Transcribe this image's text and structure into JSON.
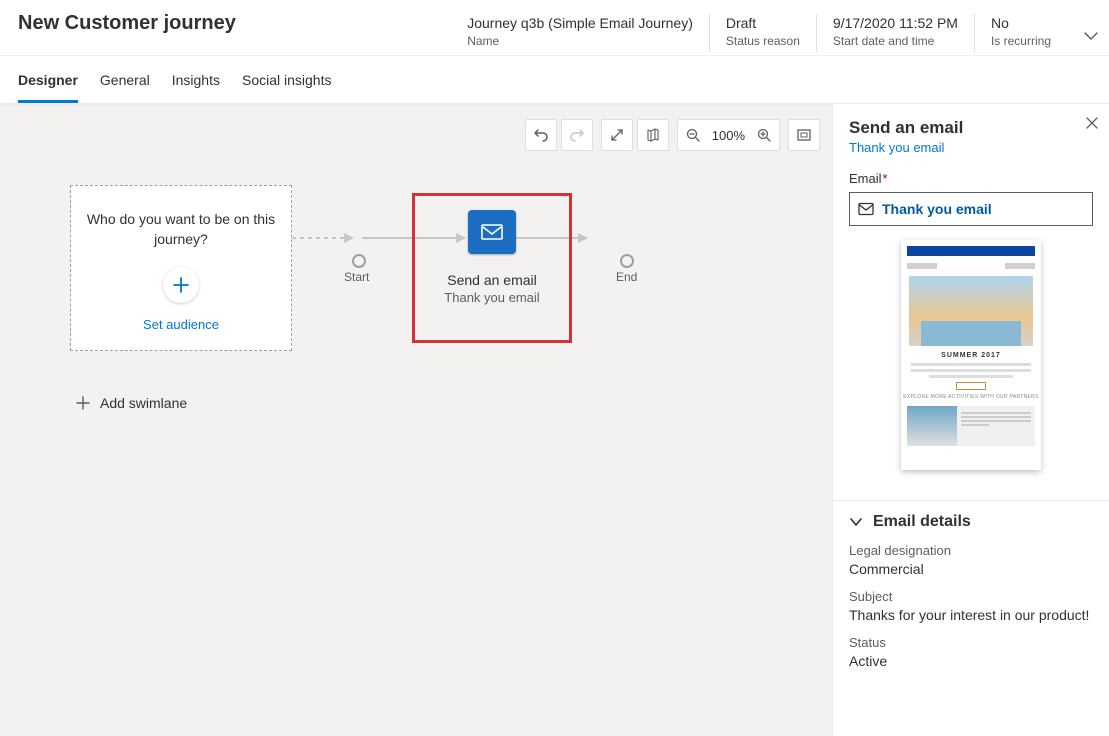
{
  "header": {
    "title": "New Customer journey",
    "name": {
      "value": "Journey q3b (Simple Email Journey)",
      "label": "Name"
    },
    "status": {
      "value": "Draft",
      "label": "Status reason"
    },
    "start": {
      "value": "9/17/2020 11:52 PM",
      "label": "Start date and time"
    },
    "recurring": {
      "value": "No",
      "label": "Is recurring"
    }
  },
  "tabs": {
    "designer": "Designer",
    "general": "General",
    "insights": "Insights",
    "social": "Social insights"
  },
  "toolbar": {
    "zoom_label": "100%"
  },
  "canvas": {
    "audience_prompt": "Who do you want to be on this journey?",
    "set_audience": "Set audience",
    "start_label": "Start",
    "end_label": "End",
    "tile_title": "Send an email",
    "tile_subtitle": "Thank you email",
    "add_swimlane": "Add swimlane"
  },
  "side": {
    "title": "Send an email",
    "subtitle": "Thank you email",
    "email_label": "Email",
    "email_value": "Thank you email",
    "preview_caption": "SUMMER 2017",
    "details": {
      "heading": "Email details",
      "legal_label": "Legal designation",
      "legal_value": "Commercial",
      "subject_label": "Subject",
      "subject_value": "Thanks for your interest in our product!",
      "status_label": "Status",
      "status_value": "Active"
    }
  }
}
